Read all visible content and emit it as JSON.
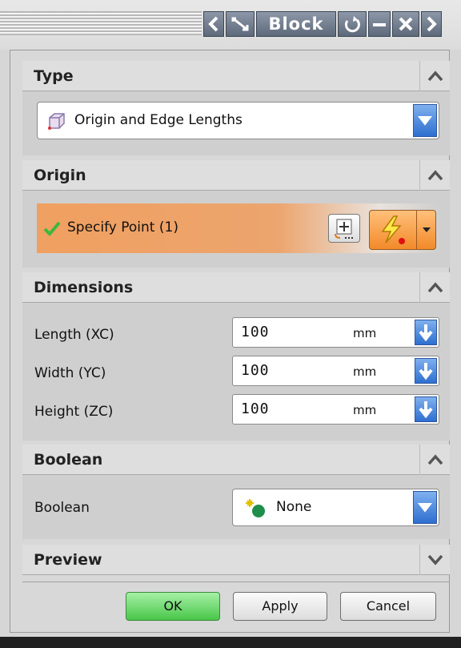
{
  "window": {
    "title": "Block",
    "buttons": [
      "prev-icon",
      "select-icon",
      "reset-icon",
      "minimize-icon",
      "close-icon",
      "next-icon"
    ]
  },
  "sections": {
    "type": {
      "header": "Type",
      "selected": "Origin and Edge Lengths"
    },
    "origin": {
      "header": "Origin",
      "specify_point": "Specify Point (1)"
    },
    "dimensions": {
      "header": "Dimensions",
      "rows": [
        {
          "label": "Length (XC)",
          "value": "100",
          "unit": "mm"
        },
        {
          "label": "Width (YC)",
          "value": "100",
          "unit": "mm"
        },
        {
          "label": "Height (ZC)",
          "value": "100",
          "unit": "mm"
        }
      ]
    },
    "boolean": {
      "header": "Boolean",
      "label": "Boolean",
      "selected": "None"
    },
    "preview": {
      "header": "Preview"
    }
  },
  "footer": {
    "ok": "OK",
    "apply": "Apply",
    "cancel": "Cancel"
  },
  "colors": {
    "accent": "#f0a060",
    "ok_green": "#5cd65c",
    "dropdown_blue": "#2e6fcf"
  }
}
